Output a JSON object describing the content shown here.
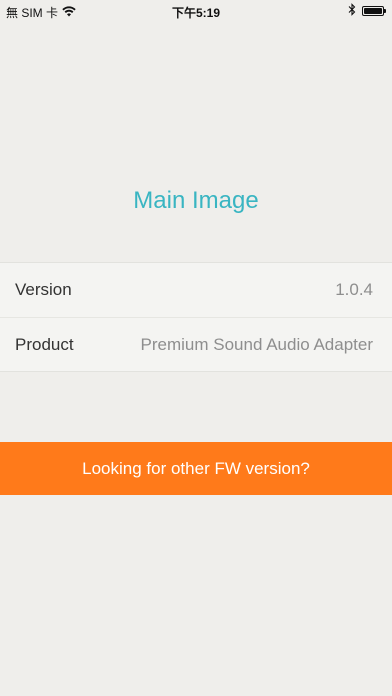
{
  "status_bar": {
    "carrier": "無 SIM 卡",
    "time": "下午5:19",
    "wifi_icon": "wifi-icon",
    "bluetooth_icon": "bluetooth-icon",
    "battery_icon": "battery-icon",
    "battery_level": 1.0
  },
  "main": {
    "title": "Main Image",
    "title_color": "#39b5c2"
  },
  "info": {
    "rows": [
      {
        "label": "Version",
        "value": "1.0.4"
      },
      {
        "label": "Product",
        "value": "Premium Sound Audio Adapter"
      }
    ]
  },
  "fw_button": {
    "label": "Looking for other FW version?",
    "color": "#ff7a1a"
  }
}
